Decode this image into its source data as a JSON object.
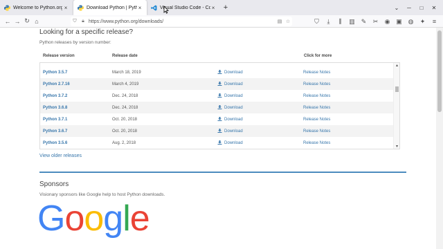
{
  "tabs": [
    {
      "title": "Welcome to Python.org"
    },
    {
      "title": "Download Python | Python.org"
    },
    {
      "title": "Visual Studio Code - Code Edi"
    }
  ],
  "tab_close_glyph": "×",
  "new_tab_glyph": "+",
  "window_controls": {
    "minimize": "─",
    "maximize": "□",
    "close": "✕"
  },
  "address_bar": {
    "url": "https://www.python.org/downloads/"
  },
  "page": {
    "heading": "Looking for a specific release?",
    "subheading": "Python releases by version number:",
    "columns": {
      "version": "Release version",
      "date": "Release date",
      "more": "Click for more"
    },
    "releases": [
      {
        "version": "Python 3.5.7",
        "date": "March 18, 2019",
        "download": "Download",
        "notes": "Release Notes"
      },
      {
        "version": "Python 2.7.16",
        "date": "March 4, 2019",
        "download": "Download",
        "notes": "Release Notes"
      },
      {
        "version": "Python 3.7.2",
        "date": "Dec. 24, 2018",
        "download": "Download",
        "notes": "Release Notes"
      },
      {
        "version": "Python 3.6.8",
        "date": "Dec. 24, 2018",
        "download": "Download",
        "notes": "Release Notes"
      },
      {
        "version": "Python 3.7.1",
        "date": "Oct. 20, 2018",
        "download": "Download",
        "notes": "Release Notes"
      },
      {
        "version": "Python 3.6.7",
        "date": "Oct. 20, 2018",
        "download": "Download",
        "notes": "Release Notes"
      },
      {
        "version": "Python 3.5.6",
        "date": "Aug. 2, 2018",
        "download": "Download",
        "notes": "Release Notes"
      }
    ],
    "older_link": "View older releases",
    "sponsors_title": "Sponsors",
    "sponsors_text": "Visionary sponsors like Google help to host Python downloads.",
    "sponsor_logo": "Google"
  },
  "colors": {
    "link": "#3776ab",
    "divider": "#4b8bbe",
    "google_blue": "#4285f4",
    "google_red": "#ea4335",
    "google_yellow": "#fbbc05",
    "google_green": "#34a853"
  }
}
